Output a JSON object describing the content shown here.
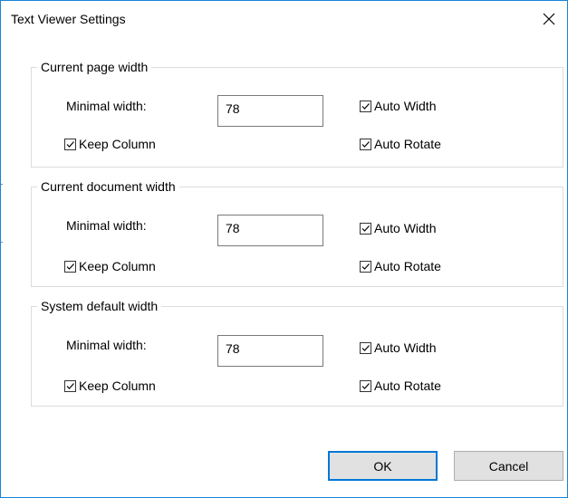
{
  "dialog": {
    "title": "Text Viewer Settings",
    "close_symbol": "✕"
  },
  "groups": [
    {
      "legend": "Current page width",
      "min_width_label": "Minimal width:",
      "min_width_value": "78",
      "keep_column_label": "Keep Column",
      "keep_column_checked": true,
      "auto_width_label": "Auto Width",
      "auto_width_checked": true,
      "auto_rotate_label": "Auto Rotate",
      "auto_rotate_checked": true
    },
    {
      "legend": "Current document width",
      "min_width_label": "Minimal width:",
      "min_width_value": "78",
      "keep_column_label": "Keep Column",
      "keep_column_checked": true,
      "auto_width_label": "Auto Width",
      "auto_width_checked": true,
      "auto_rotate_label": "Auto Rotate",
      "auto_rotate_checked": true
    },
    {
      "legend": "System default width",
      "min_width_label": "Minimal width:",
      "min_width_value": "78",
      "keep_column_label": "Keep Column",
      "keep_column_checked": true,
      "auto_width_label": "Auto Width",
      "auto_width_checked": true,
      "auto_rotate_label": "Auto Rotate",
      "auto_rotate_checked": true
    }
  ],
  "buttons": {
    "ok_label": "OK",
    "cancel_label": "Cancel"
  },
  "colors": {
    "window_border": "#1883d7",
    "default_button_border": "#0078d7",
    "button_face": "#e1e1e1",
    "groupbox_border": "#dcdcdc"
  },
  "icons": {
    "close": "close-icon",
    "checkbox": "checkmark-icon"
  }
}
